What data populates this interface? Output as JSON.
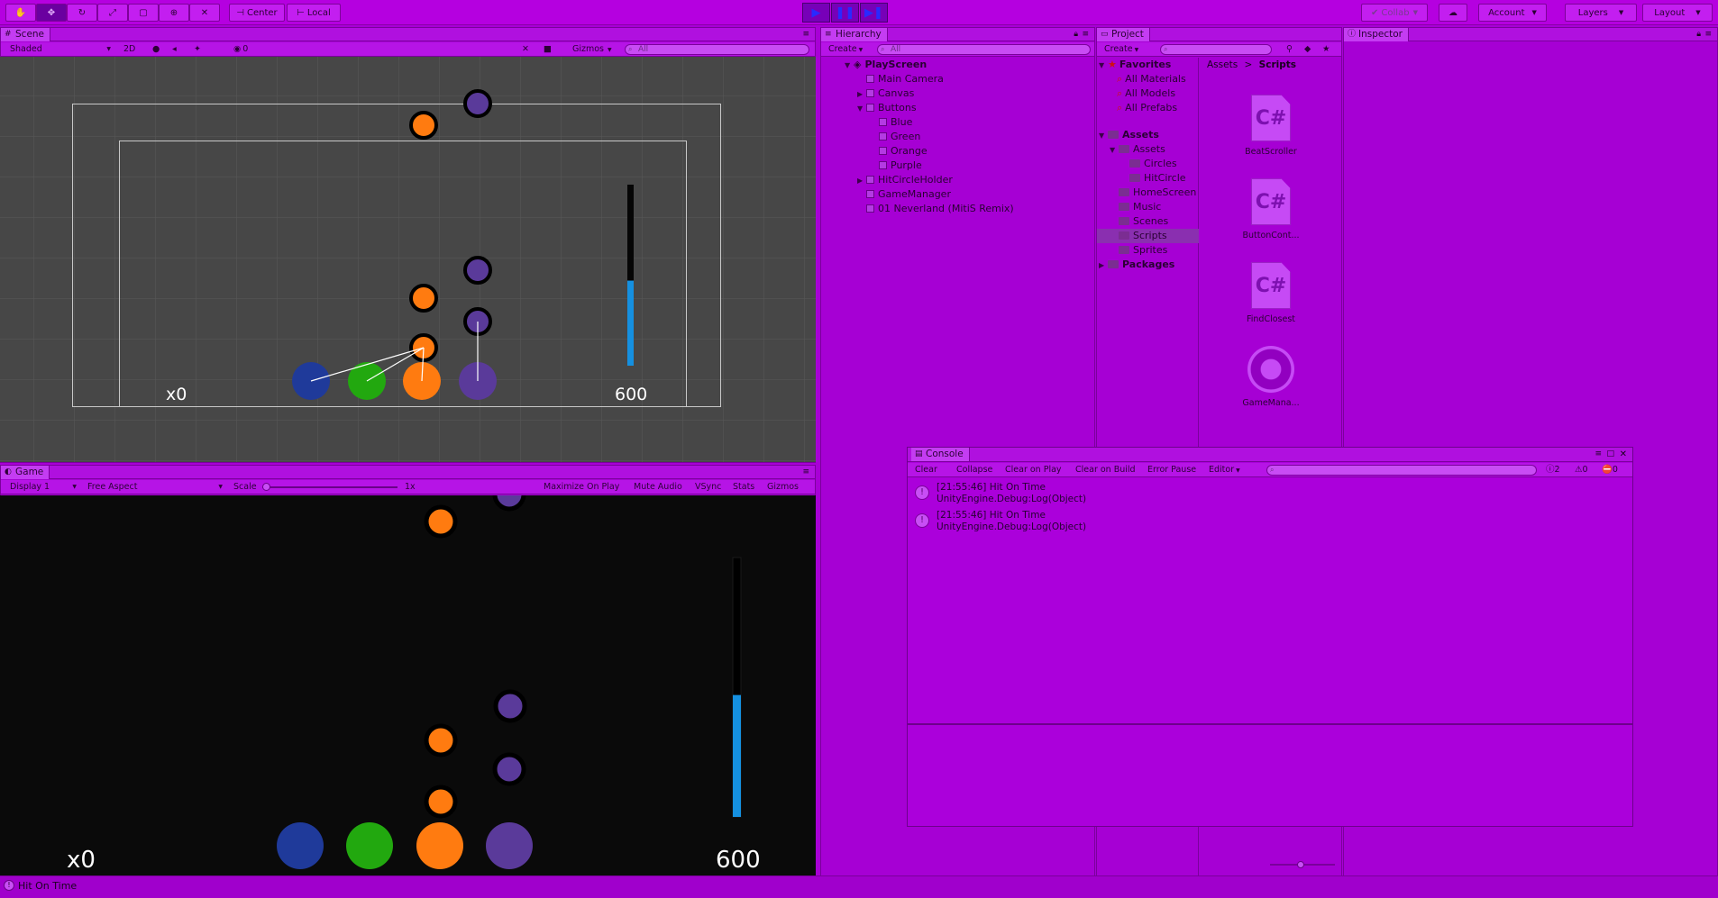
{
  "toolbar": {
    "pivot_label": "Center",
    "space_label": "Local",
    "collab_label": "Collab",
    "account_label": "Account",
    "layers_label": "Layers",
    "layout_label": "Layout"
  },
  "scene_panel": {
    "tab": "Scene",
    "shading_mode": "Shaded",
    "mode_2d": "2D",
    "hidden_count": "0",
    "gizmos_label": "Gizmos",
    "search_placeholder": "All",
    "combo_text": "x0",
    "score_text": "600"
  },
  "game_panel": {
    "tab": "Game",
    "display": "Display 1",
    "aspect": "Free Aspect",
    "scale_label": "Scale",
    "scale_value": "1x",
    "buttons": [
      "Maximize On Play",
      "Mute Audio",
      "VSync",
      "Stats",
      "Gizmos"
    ],
    "combo_text": "x0",
    "score_text": "600",
    "progress_fraction": 0.47
  },
  "hierarchy": {
    "tab": "Hierarchy",
    "create_label": "Create",
    "search_placeholder": "All",
    "scene_name": "PlayScreen",
    "items": [
      {
        "label": "Main Camera",
        "indent": 1
      },
      {
        "label": "Canvas",
        "indent": 1
      },
      {
        "label": "Buttons",
        "indent": 1
      },
      {
        "label": "Blue",
        "indent": 2
      },
      {
        "label": "Green",
        "indent": 2
      },
      {
        "label": "Orange",
        "indent": 2
      },
      {
        "label": "Purple",
        "indent": 2
      },
      {
        "label": "HitCircleHolder",
        "indent": 1
      },
      {
        "label": "GameManager",
        "indent": 1
      },
      {
        "label": "01 Neverland (MitiS Remix)",
        "indent": 1
      }
    ]
  },
  "project": {
    "tab": "Project",
    "create_label": "Create",
    "favorites_label": "Favorites",
    "favorites": [
      "All Materials",
      "All Models",
      "All Prefabs"
    ],
    "assets_label": "Assets",
    "folders": [
      "Assets",
      "Circles",
      "HitCircle",
      "HomeScreen",
      "Music",
      "Scenes",
      "Scripts",
      "Sprites"
    ],
    "packages_label": "Packages",
    "breadcrumb": [
      "Assets",
      "Scripts"
    ],
    "breadcrumb_sep": ">",
    "files": [
      {
        "name": "BeatScroller",
        "icon": "C#"
      },
      {
        "name": "ButtonCont...",
        "icon": "C#"
      },
      {
        "name": "FindClosest",
        "icon": "C#"
      },
      {
        "name": "GameMana...",
        "icon": "gear"
      }
    ]
  },
  "inspector": {
    "tab": "Inspector"
  },
  "console": {
    "tab": "Console",
    "buttons": [
      "Clear",
      "Collapse",
      "Clear on Play",
      "Clear on Build",
      "Error Pause",
      "Editor"
    ],
    "counts": [
      "2",
      "0",
      "0"
    ],
    "logs": [
      {
        "line1": "[21:55:46] Hit On Time",
        "line2": "UnityEngine.Debug:Log(Object)"
      },
      {
        "line1": "[21:55:46] Hit On Time",
        "line2": "UnityEngine.Debug:Log(Object)"
      }
    ]
  },
  "statusbar": {
    "message": "Hit On Time"
  },
  "colors": {
    "blue": "#1f3a9a",
    "green": "#22a80f",
    "orange": "#ff7b10",
    "purple": "#5a3a9a",
    "meter": "#1590e0",
    "editor_bg": "#a800d6"
  }
}
